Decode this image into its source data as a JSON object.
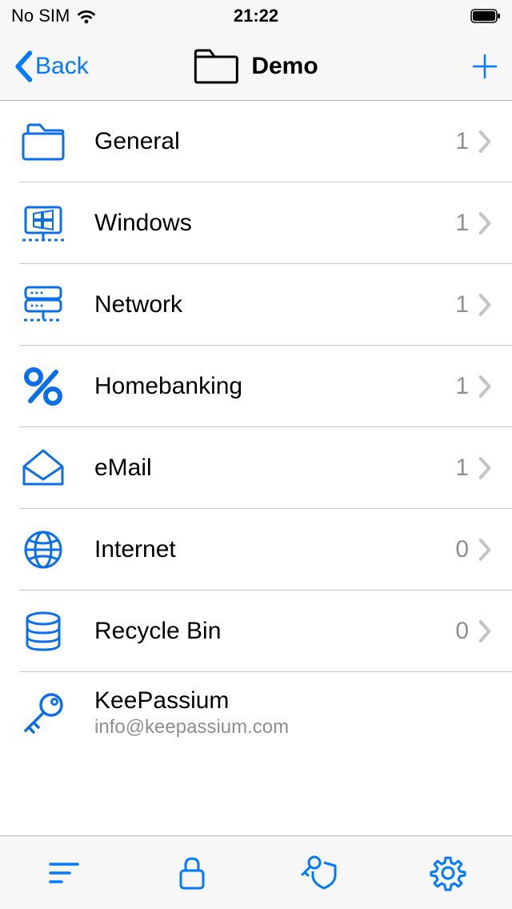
{
  "status": {
    "carrier": "No SIM",
    "time": "21:22"
  },
  "nav": {
    "back_label": "Back",
    "title": "Demo"
  },
  "groups": [
    {
      "icon": "folder",
      "label": "General",
      "count": "1",
      "chevron": true
    },
    {
      "icon": "monitor",
      "label": "Windows",
      "count": "1",
      "chevron": true
    },
    {
      "icon": "server",
      "label": "Network",
      "count": "1",
      "chevron": true
    },
    {
      "icon": "percent",
      "label": "Homebanking",
      "count": "1",
      "chevron": true
    },
    {
      "icon": "mail",
      "label": "eMail",
      "count": "1",
      "chevron": true
    },
    {
      "icon": "globe",
      "label": "Internet",
      "count": "0",
      "chevron": true
    },
    {
      "icon": "database",
      "label": "Recycle Bin",
      "count": "0",
      "chevron": true
    }
  ],
  "entry": {
    "icon": "key",
    "title": "KeePassium",
    "subtitle": "info@keepassium.com"
  },
  "colors": {
    "accent": "#007aff",
    "icon_blue": "#0a6fe8",
    "muted": "#8e8e93"
  }
}
